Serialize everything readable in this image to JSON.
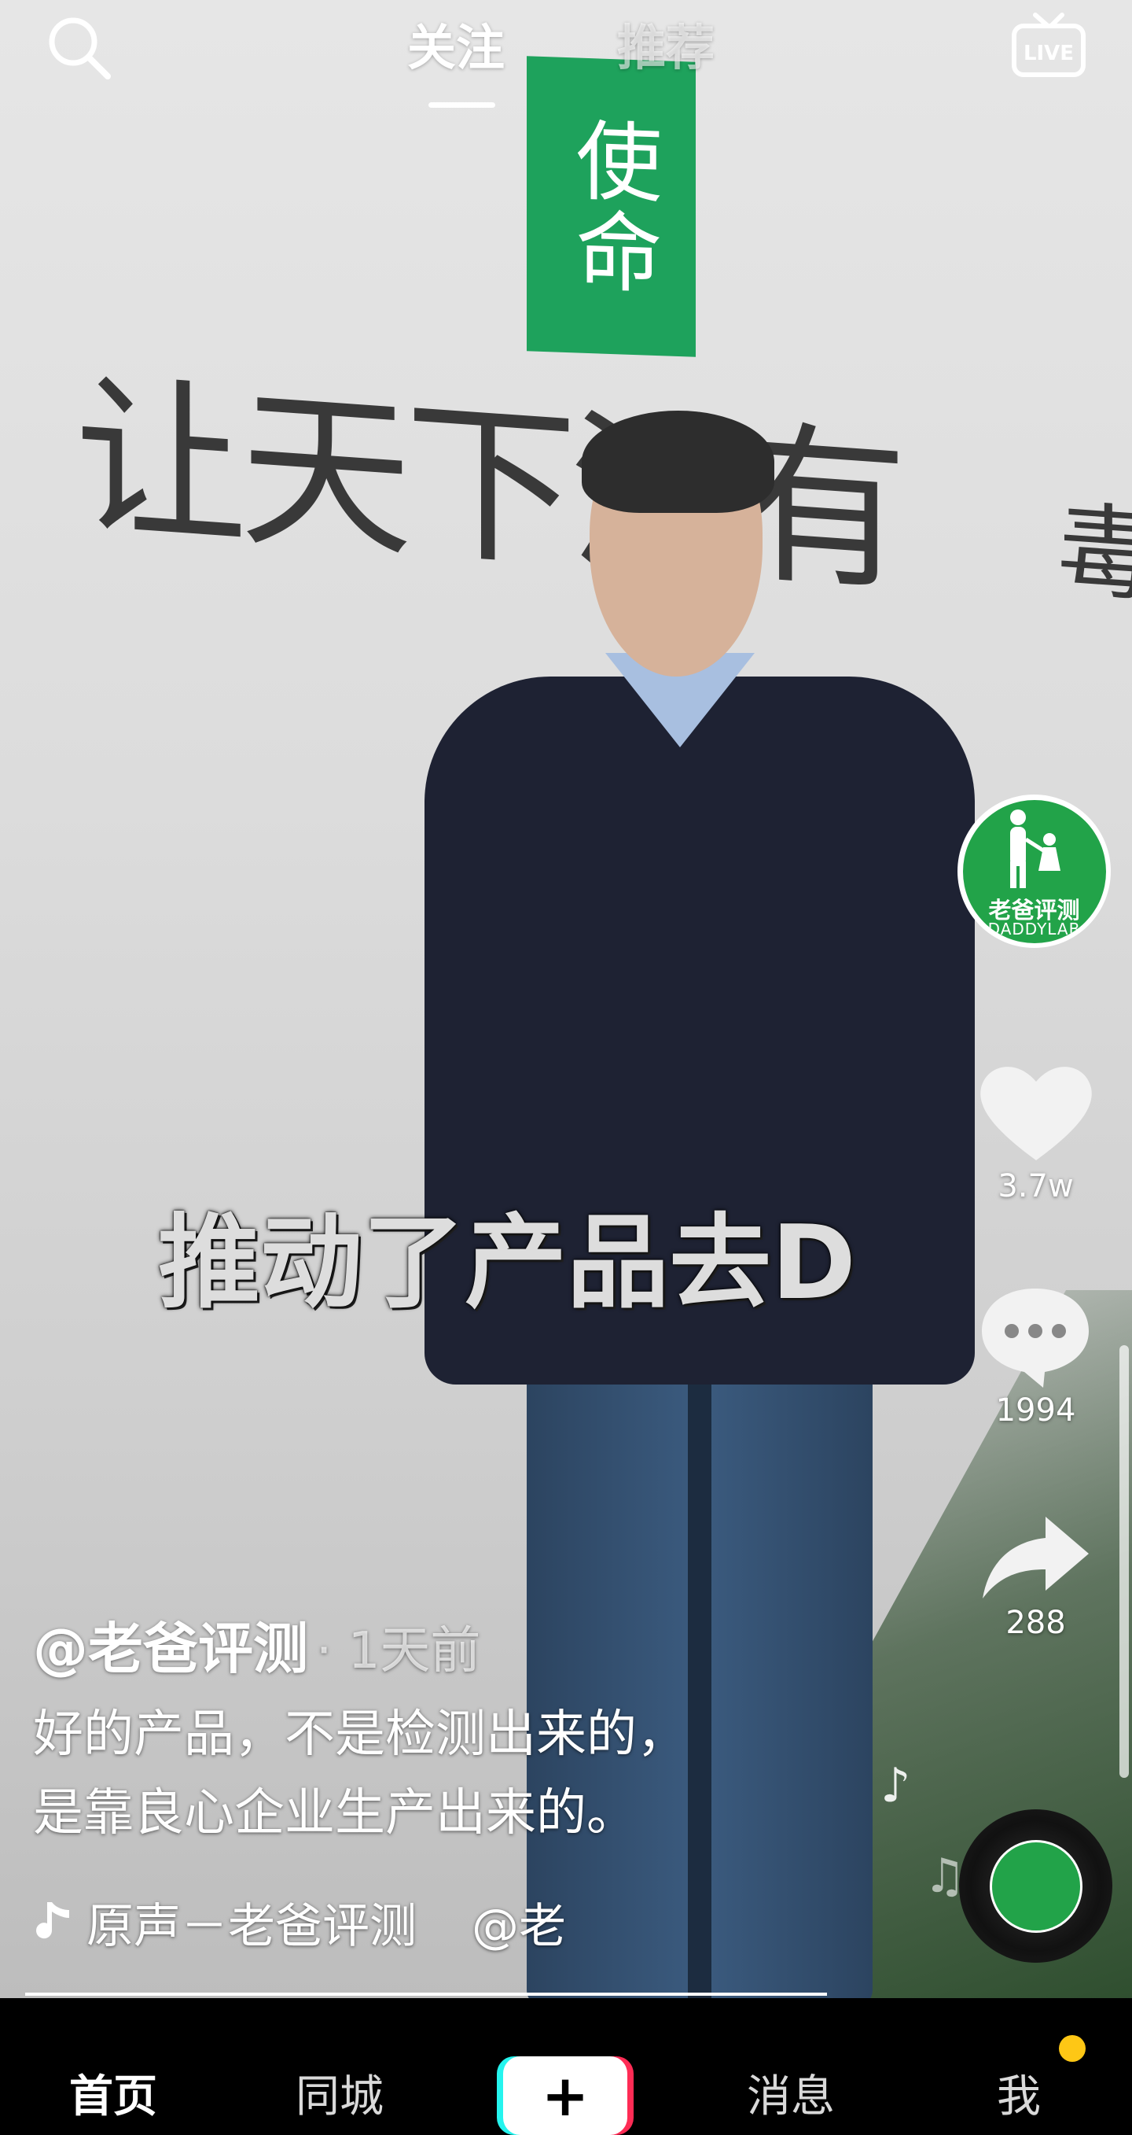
{
  "top_tabs": {
    "follow": "关注",
    "recommend": "推荐"
  },
  "video": {
    "wall_sign": "使命",
    "wall_slogan": "让天下没有",
    "wall_slogan_tail": "毒产品",
    "subtitle": "推动了产品去D"
  },
  "creator": {
    "avatar_name": "老爸评测",
    "avatar_en": "DADDYLAB",
    "handle": "@老爸评测",
    "time": "· 1天前"
  },
  "actions": {
    "likes": "3.7w",
    "comments": "1994",
    "shares": "288"
  },
  "description_line1": "好的产品，不是检测出来的，",
  "description_line2": "是靠良心企业生产出来的。",
  "music": {
    "title": "原声－老爸评测",
    "mention": "@老"
  },
  "bottom_nav": {
    "home": "首页",
    "city": "同城",
    "create": "+",
    "messages": "消息",
    "me": "我"
  },
  "colors": {
    "accent_green": "#22a349",
    "cyan": "#25f4ee",
    "red": "#fe2c55",
    "badge": "#fec715"
  }
}
